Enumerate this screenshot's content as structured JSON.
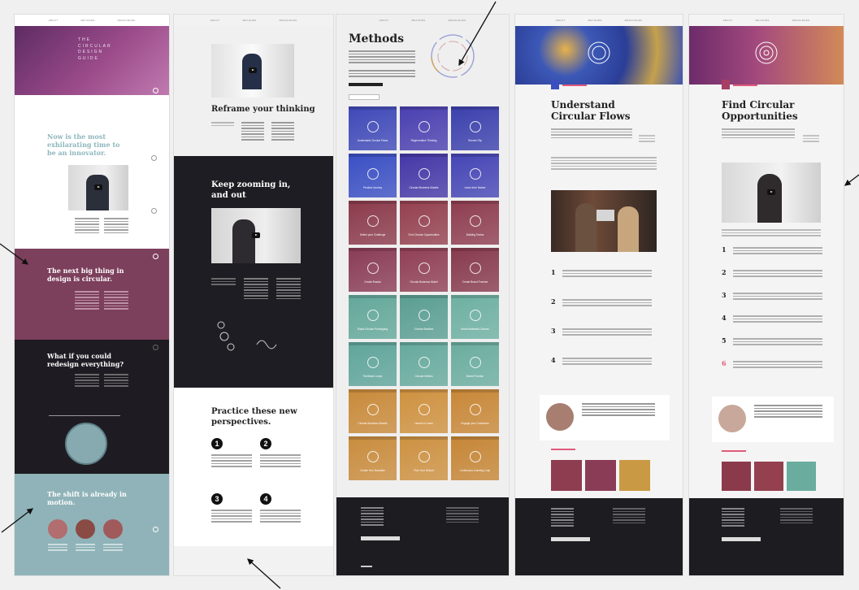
{
  "col1": {
    "hero_title": "THE\nCIRCULAR\nDESIGN\nGUIDE",
    "innovator_heading": "Now is the most exhilarating time to be an innovator.",
    "big_thing_heading": "The next big thing in design is circular.",
    "redesign_heading": "What if you could redesign everything?",
    "shift_heading": "The shift is already in motion."
  },
  "col2": {
    "reframe_heading": "Reframe your thinking",
    "zoom_heading": "Keep zooming in, and out",
    "practice_heading": "Practice these new perspectives.",
    "steps": [
      "1",
      "2",
      "3",
      "4"
    ]
  },
  "col3": {
    "title": "Methods",
    "tiles": [
      {
        "label": "Understand Circular Flows",
        "color": "#3f49b8"
      },
      {
        "label": "Regenerative Thinking",
        "color": "#4a3fb0"
      },
      {
        "label": "Service Flip",
        "color": "#3b40ad"
      },
      {
        "label": "Product Journey",
        "color": "#3a4fc4"
      },
      {
        "label": "Circular Business Models",
        "color": "#4437a7"
      },
      {
        "label": "Learn from Nature",
        "color": "#4545b6"
      },
      {
        "label": "Define your Challenge",
        "color": "#8b3a4b"
      },
      {
        "label": "Find Circular Opportunities",
        "color": "#94404f"
      },
      {
        "label": "Building Teams",
        "color": "#8e3d50"
      },
      {
        "label": "Create Brands",
        "color": "#8a3c56"
      },
      {
        "label": "Circular Business Model",
        "color": "#903f55"
      },
      {
        "label": "Create Brand Promise",
        "color": "#873a4d"
      },
      {
        "label": "Rapid Circular Prototyping",
        "color": "#63a89a"
      },
      {
        "label": "Circular Buddies",
        "color": "#5a9e92"
      },
      {
        "label": "Smart Materials Choices",
        "color": "#6db0a2"
      },
      {
        "label": "Feedback Loops",
        "color": "#5fa59b"
      },
      {
        "label": "Circular Metrics",
        "color": "#66aa9d"
      },
      {
        "label": "Brand Promise",
        "color": "#6aad9f"
      },
      {
        "label": "Circular Business Models",
        "color": "#c98a3a"
      },
      {
        "label": "Launch to Learn",
        "color": "#cf913f"
      },
      {
        "label": "Engage your Customers",
        "color": "#c88737"
      },
      {
        "label": "Create Your Narrative",
        "color": "#c98c3d"
      },
      {
        "label": "Plan Your Rollout",
        "color": "#cd9141"
      },
      {
        "label": "Continuous Learning Loop",
        "color": "#c68636"
      }
    ]
  },
  "col4": {
    "title": "Understand Circular Flows",
    "steps": [
      "1",
      "2",
      "3",
      "4"
    ]
  },
  "col5": {
    "title": "Find Circular Opportunities",
    "steps": [
      "1",
      "2",
      "3",
      "4",
      "5",
      "6"
    ]
  }
}
